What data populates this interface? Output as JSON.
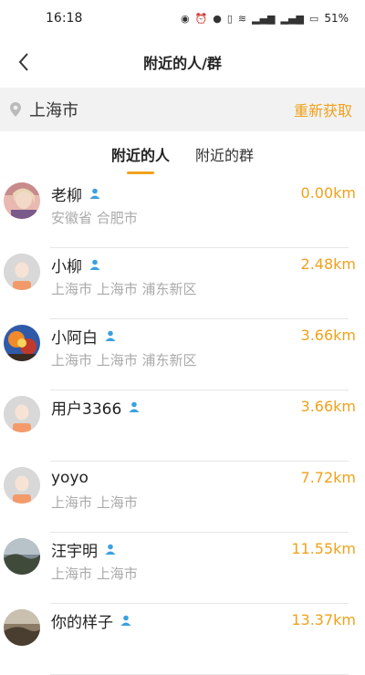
{
  "status": {
    "time": "16:18",
    "battery": "51%"
  },
  "header": {
    "title": "附近的人/群"
  },
  "location": {
    "city": "上海市",
    "refresh_label": "重新获取"
  },
  "tabs": [
    {
      "label": "附近的人"
    },
    {
      "label": "附近的群"
    }
  ],
  "people": [
    {
      "name": "老柳",
      "address": "安徽省 合肥市",
      "distance": "0.00km",
      "avatar": "photo-woman"
    },
    {
      "name": "小柳",
      "address": "上海市 上海市 浦东新区",
      "distance": "2.48km",
      "avatar": "default"
    },
    {
      "name": "小阿白",
      "address": "上海市 上海市 浦东新区",
      "distance": "3.66km",
      "avatar": "photo-cartoon"
    },
    {
      "name": "用户3366",
      "address": "",
      "distance": "3.66km",
      "avatar": "default"
    },
    {
      "name": "yoyo",
      "address": "上海市 上海市",
      "distance": "7.72km",
      "avatar": "default"
    },
    {
      "name": "汪宇明",
      "address": "上海市 上海市",
      "distance": "11.55km",
      "avatar": "photo-landscape"
    },
    {
      "name": "你的样子",
      "address": "",
      "distance": "13.37km",
      "avatar": "photo-landscape2"
    }
  ],
  "colors": {
    "accent": "#f0a11c",
    "person_icon": "#3aa0e0"
  }
}
